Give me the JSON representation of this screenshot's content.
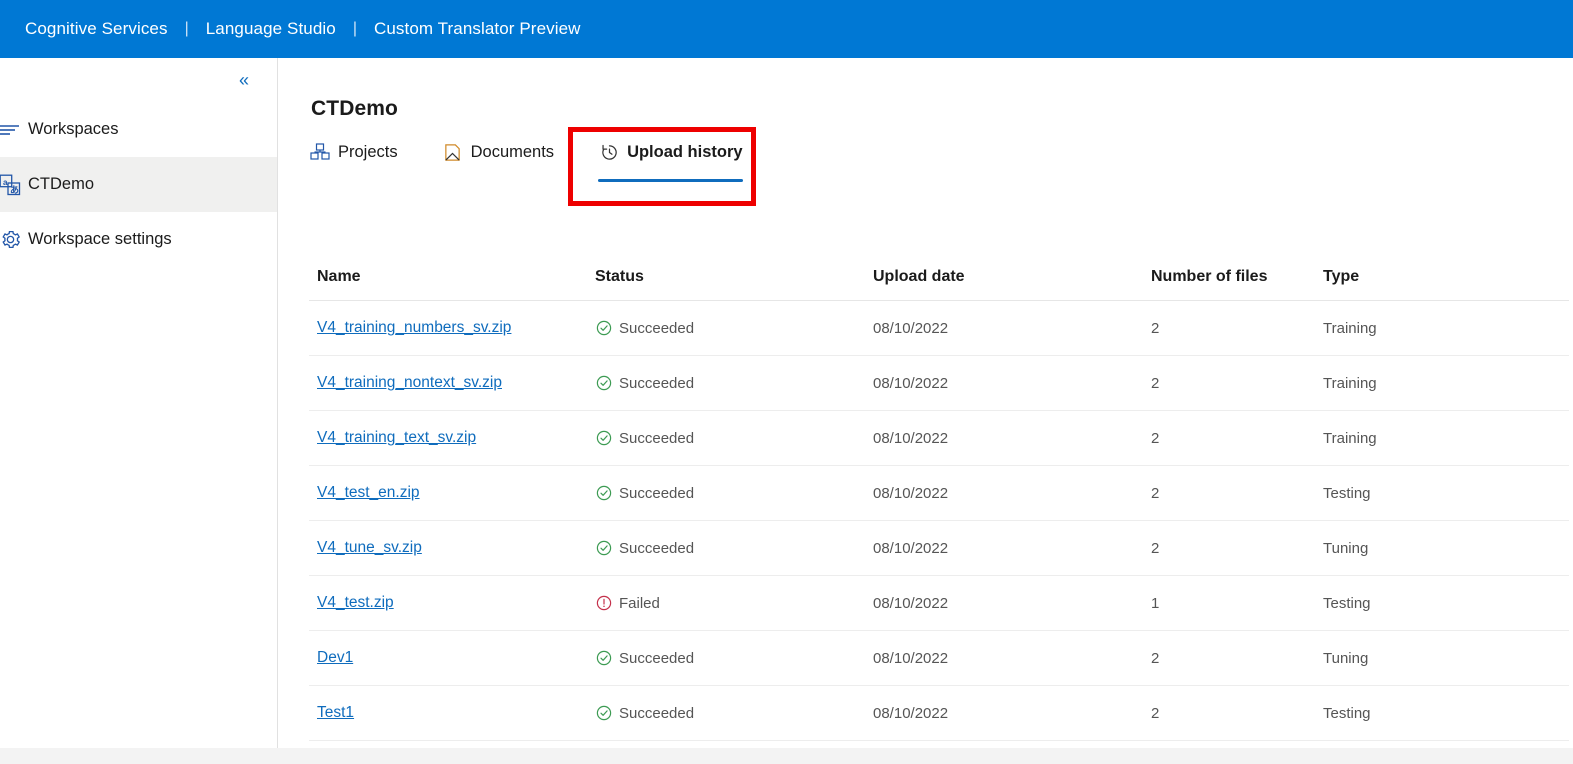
{
  "header": {
    "brand": "Cognitive Services",
    "separator": "|",
    "product": "Language Studio",
    "section": "Custom Translator Preview"
  },
  "sidebar": {
    "collapse_icon": "chevron-double-left-icon",
    "collapse_glyph": "«",
    "items": [
      {
        "label": "Workspaces",
        "icon": "list-icon",
        "selected": false
      },
      {
        "label": "CTDemo",
        "icon": "translate-icon",
        "selected": true
      },
      {
        "label": "Workspace settings",
        "icon": "gear-icon",
        "selected": false
      }
    ]
  },
  "main": {
    "title": "CTDemo",
    "tabs": [
      {
        "label": "Projects",
        "icon": "projects-cubes-icon",
        "active": false
      },
      {
        "label": "Documents",
        "icon": "document-icon",
        "active": false
      },
      {
        "label": "Upload history",
        "icon": "history-clock-icon",
        "active": true
      }
    ],
    "active_tab_underline_color": "#0f6cbd",
    "annotation": {
      "shape": "rectangle",
      "color": "#ee0000",
      "target": "Upload history"
    }
  },
  "table": {
    "columns": [
      "Name",
      "Status",
      "Upload date",
      "Number of files",
      "Type"
    ],
    "rows": [
      {
        "name": "V4_training_numbers_sv.zip",
        "status": "Succeeded",
        "status_kind": "success",
        "date": "08/10/2022",
        "files": "2",
        "type": "Training"
      },
      {
        "name": "V4_training_nontext_sv.zip",
        "status": "Succeeded",
        "status_kind": "success",
        "date": "08/10/2022",
        "files": "2",
        "type": "Training"
      },
      {
        "name": "V4_training_text_sv.zip",
        "status": "Succeeded",
        "status_kind": "success",
        "date": "08/10/2022",
        "files": "2",
        "type": "Training"
      },
      {
        "name": "V4_test_en.zip",
        "status": "Succeeded",
        "status_kind": "success",
        "date": "08/10/2022",
        "files": "2",
        "type": "Testing"
      },
      {
        "name": "V4_tune_sv.zip",
        "status": "Succeeded",
        "status_kind": "success",
        "date": "08/10/2022",
        "files": "2",
        "type": "Tuning"
      },
      {
        "name": "V4_test.zip",
        "status": "Failed",
        "status_kind": "error",
        "date": "08/10/2022",
        "files": "1",
        "type": "Testing"
      },
      {
        "name": "Dev1",
        "status": "Succeeded",
        "status_kind": "success",
        "date": "08/10/2022",
        "files": "2",
        "type": "Tuning"
      },
      {
        "name": "Test1",
        "status": "Succeeded",
        "status_kind": "success",
        "date": "08/10/2022",
        "files": "2",
        "type": "Testing"
      }
    ]
  },
  "colors": {
    "header_blue": "#0078d4",
    "link_blue": "#0f6cbd",
    "success_green": "#3d9b53",
    "error_red": "#c4314b",
    "annotation_red": "#ee0000",
    "selected_row_gray": "#f0f0ef"
  }
}
